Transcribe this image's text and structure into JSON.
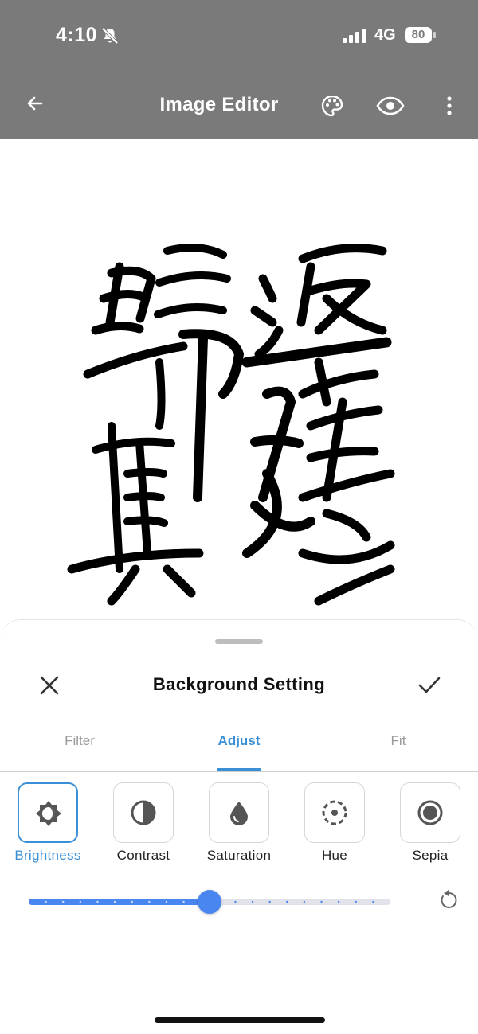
{
  "status_bar": {
    "time": "4:10",
    "network": "4G",
    "battery": "80"
  },
  "app_bar": {
    "title": "Image Editor"
  },
  "sheet": {
    "title": "Background Setting",
    "tabs": [
      {
        "label": "Filter",
        "active": false
      },
      {
        "label": "Adjust",
        "active": true
      },
      {
        "label": "Fit",
        "active": false
      }
    ],
    "tools": [
      {
        "label": "Brightness",
        "icon": "brightness-icon",
        "active": true
      },
      {
        "label": "Contrast",
        "icon": "contrast-icon",
        "active": false
      },
      {
        "label": "Saturation",
        "icon": "drop-icon",
        "active": false
      },
      {
        "label": "Hue",
        "icon": "hue-icon",
        "active": false
      },
      {
        "label": "Sepia",
        "icon": "sepia-icon",
        "active": false
      }
    ],
    "slider": {
      "value": 0.5
    }
  },
  "colors": {
    "accent": "#3a8fd6",
    "slider": "#4a86f0",
    "header": "#7a7a7a"
  }
}
